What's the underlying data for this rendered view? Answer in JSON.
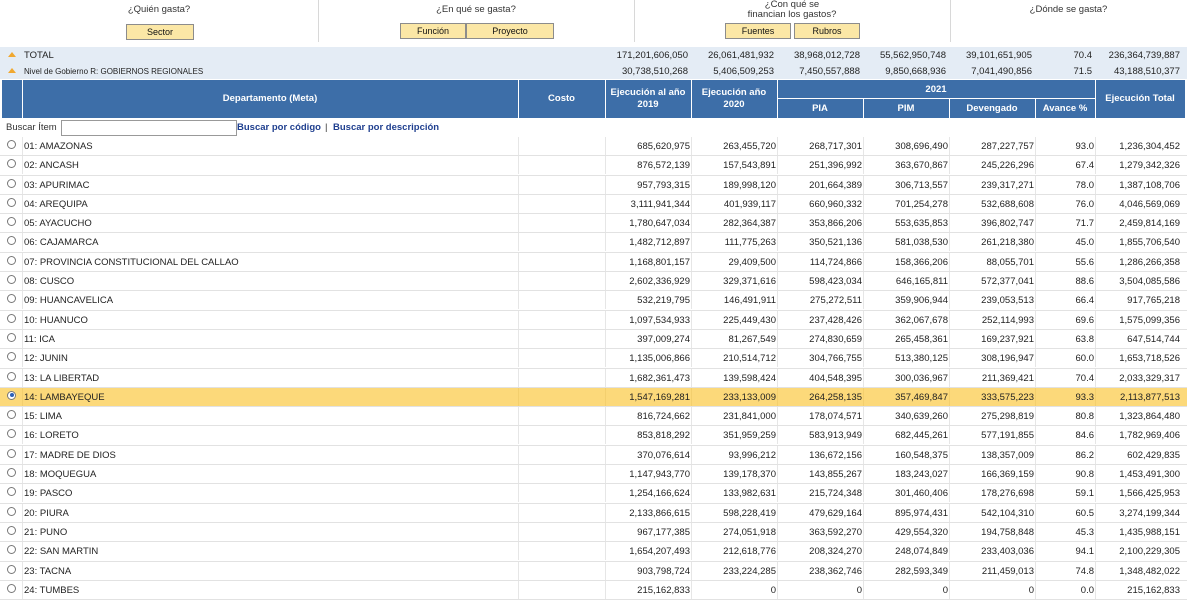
{
  "nav": {
    "who": {
      "question": "¿Quién gasta?",
      "buttons": [
        "Sector"
      ]
    },
    "what": {
      "question": "¿En qué se gasta?",
      "buttons": [
        "Función",
        "Proyecto"
      ]
    },
    "funding": {
      "question_line1": "¿Con qué se",
      "question_line2": "financian los gastos?",
      "buttons": [
        "Fuentes",
        "Rubros"
      ]
    },
    "where": {
      "question": "¿Dónde se gasta?"
    }
  },
  "totals": [
    {
      "label": "TOTAL",
      "costo": "",
      "ej2019": "171,201,606,050",
      "ej2020": "26,061,481,932",
      "pia": "38,968,012,728",
      "pim": "55,562,950,748",
      "devengado": "39,101,651,905",
      "avance": "70.4",
      "total": "236,364,739,887"
    },
    {
      "label": "Nivel de Gobierno R: GOBIERNOS REGIONALES",
      "costo": "",
      "ej2019": "30,738,510,268",
      "ej2020": "5,406,509,253",
      "pia": "7,450,557,888",
      "pim": "9,850,668,936",
      "devengado": "7,041,490,856",
      "avance": "71.5",
      "total": "43,188,510,377"
    }
  ],
  "header": {
    "departamento": "Departamento (Meta)",
    "costo": "Costo",
    "ej2019_l1": "Ejecución al año",
    "ej2019_l2": "2019",
    "ej2020_l1": "Ejecución año",
    "ej2020_l2": "2020",
    "year": "2021",
    "pia": "PIA",
    "pim": "PIM",
    "devengado": "Devengado",
    "avance": "Avance %",
    "total": "Ejecución Total"
  },
  "search": {
    "label": "Buscar Ítem",
    "value": "",
    "by_code": "Buscar por código",
    "separator": "|",
    "by_desc": "Buscar por descripción"
  },
  "selected_index": 13,
  "rows": [
    {
      "name": "01: AMAZONAS",
      "ej2019": "685,620,975",
      "ej2020": "263,455,720",
      "pia": "268,717,301",
      "pim": "308,696,490",
      "dev": "287,227,757",
      "av": "93.0",
      "total": "1,236,304,452"
    },
    {
      "name": "02: ANCASH",
      "ej2019": "876,572,139",
      "ej2020": "157,543,891",
      "pia": "251,396,992",
      "pim": "363,670,867",
      "dev": "245,226,296",
      "av": "67.4",
      "total": "1,279,342,326"
    },
    {
      "name": "03: APURIMAC",
      "ej2019": "957,793,315",
      "ej2020": "189,998,120",
      "pia": "201,664,389",
      "pim": "306,713,557",
      "dev": "239,317,271",
      "av": "78.0",
      "total": "1,387,108,706"
    },
    {
      "name": "04: AREQUIPA",
      "ej2019": "3,111,941,344",
      "ej2020": "401,939,117",
      "pia": "660,960,332",
      "pim": "701,254,278",
      "dev": "532,688,608",
      "av": "76.0",
      "total": "4,046,569,069"
    },
    {
      "name": "05: AYACUCHO",
      "ej2019": "1,780,647,034",
      "ej2020": "282,364,387",
      "pia": "353,866,206",
      "pim": "553,635,853",
      "dev": "396,802,747",
      "av": "71.7",
      "total": "2,459,814,169"
    },
    {
      "name": "06: CAJAMARCA",
      "ej2019": "1,482,712,897",
      "ej2020": "111,775,263",
      "pia": "350,521,136",
      "pim": "581,038,530",
      "dev": "261,218,380",
      "av": "45.0",
      "total": "1,855,706,540"
    },
    {
      "name": "07: PROVINCIA CONSTITUCIONAL DEL CALLAO",
      "ej2019": "1,168,801,157",
      "ej2020": "29,409,500",
      "pia": "114,724,866",
      "pim": "158,366,206",
      "dev": "88,055,701",
      "av": "55.6",
      "total": "1,286,266,358"
    },
    {
      "name": "08: CUSCO",
      "ej2019": "2,602,336,929",
      "ej2020": "329,371,616",
      "pia": "598,423,034",
      "pim": "646,165,811",
      "dev": "572,377,041",
      "av": "88.6",
      "total": "3,504,085,586"
    },
    {
      "name": "09: HUANCAVELICA",
      "ej2019": "532,219,795",
      "ej2020": "146,491,911",
      "pia": "275,272,511",
      "pim": "359,906,944",
      "dev": "239,053,513",
      "av": "66.4",
      "total": "917,765,218"
    },
    {
      "name": "10: HUANUCO",
      "ej2019": "1,097,534,933",
      "ej2020": "225,449,430",
      "pia": "237,428,426",
      "pim": "362,067,678",
      "dev": "252,114,993",
      "av": "69.6",
      "total": "1,575,099,356"
    },
    {
      "name": "11: ICA",
      "ej2019": "397,009,274",
      "ej2020": "81,267,549",
      "pia": "274,830,659",
      "pim": "265,458,361",
      "dev": "169,237,921",
      "av": "63.8",
      "total": "647,514,744"
    },
    {
      "name": "12: JUNIN",
      "ej2019": "1,135,006,866",
      "ej2020": "210,514,712",
      "pia": "304,766,755",
      "pim": "513,380,125",
      "dev": "308,196,947",
      "av": "60.0",
      "total": "1,653,718,526"
    },
    {
      "name": "13: LA LIBERTAD",
      "ej2019": "1,682,361,473",
      "ej2020": "139,598,424",
      "pia": "404,548,395",
      "pim": "300,036,967",
      "dev": "211,369,421",
      "av": "70.4",
      "total": "2,033,329,317"
    },
    {
      "name": "14: LAMBAYEQUE",
      "ej2019": "1,547,169,281",
      "ej2020": "233,133,009",
      "pia": "264,258,135",
      "pim": "357,469,847",
      "dev": "333,575,223",
      "av": "93.3",
      "total": "2,113,877,513"
    },
    {
      "name": "15: LIMA",
      "ej2019": "816,724,662",
      "ej2020": "231,841,000",
      "pia": "178,074,571",
      "pim": "340,639,260",
      "dev": "275,298,819",
      "av": "80.8",
      "total": "1,323,864,480"
    },
    {
      "name": "16: LORETO",
      "ej2019": "853,818,292",
      "ej2020": "351,959,259",
      "pia": "583,913,949",
      "pim": "682,445,261",
      "dev": "577,191,855",
      "av": "84.6",
      "total": "1,782,969,406"
    },
    {
      "name": "17: MADRE DE DIOS",
      "ej2019": "370,076,614",
      "ej2020": "93,996,212",
      "pia": "136,672,156",
      "pim": "160,548,375",
      "dev": "138,357,009",
      "av": "86.2",
      "total": "602,429,835"
    },
    {
      "name": "18: MOQUEGUA",
      "ej2019": "1,147,943,770",
      "ej2020": "139,178,370",
      "pia": "143,855,267",
      "pim": "183,243,027",
      "dev": "166,369,159",
      "av": "90.8",
      "total": "1,453,491,300"
    },
    {
      "name": "19: PASCO",
      "ej2019": "1,254,166,624",
      "ej2020": "133,982,631",
      "pia": "215,724,348",
      "pim": "301,460,406",
      "dev": "178,276,698",
      "av": "59.1",
      "total": "1,566,425,953"
    },
    {
      "name": "20: PIURA",
      "ej2019": "2,133,866,615",
      "ej2020": "598,228,419",
      "pia": "479,629,164",
      "pim": "895,974,431",
      "dev": "542,104,310",
      "av": "60.5",
      "total": "3,274,199,344"
    },
    {
      "name": "21: PUNO",
      "ej2019": "967,177,385",
      "ej2020": "274,051,918",
      "pia": "363,592,270",
      "pim": "429,554,320",
      "dev": "194,758,848",
      "av": "45.3",
      "total": "1,435,988,151"
    },
    {
      "name": "22: SAN MARTIN",
      "ej2019": "1,654,207,493",
      "ej2020": "212,618,776",
      "pia": "208,324,270",
      "pim": "248,074,849",
      "dev": "233,403,036",
      "av": "94.1",
      "total": "2,100,229,305"
    },
    {
      "name": "23: TACNA",
      "ej2019": "903,798,724",
      "ej2020": "233,224,285",
      "pia": "238,362,746",
      "pim": "282,593,349",
      "dev": "211,459,013",
      "av": "74.8",
      "total": "1,348,482,022"
    },
    {
      "name": "24: TUMBES",
      "ej2019": "215,162,833",
      "ej2020": "0",
      "pia": "0",
      "pim": "0",
      "dev": "0",
      "av": "0.0",
      "total": "215,162,833"
    }
  ],
  "colors": {
    "header_bg": "#3d6ea8",
    "selected_row": "#fcd97a",
    "totals_bg": "#e4ecf5",
    "nav_button": "#fbe7a6",
    "link": "#1f3f8f"
  }
}
